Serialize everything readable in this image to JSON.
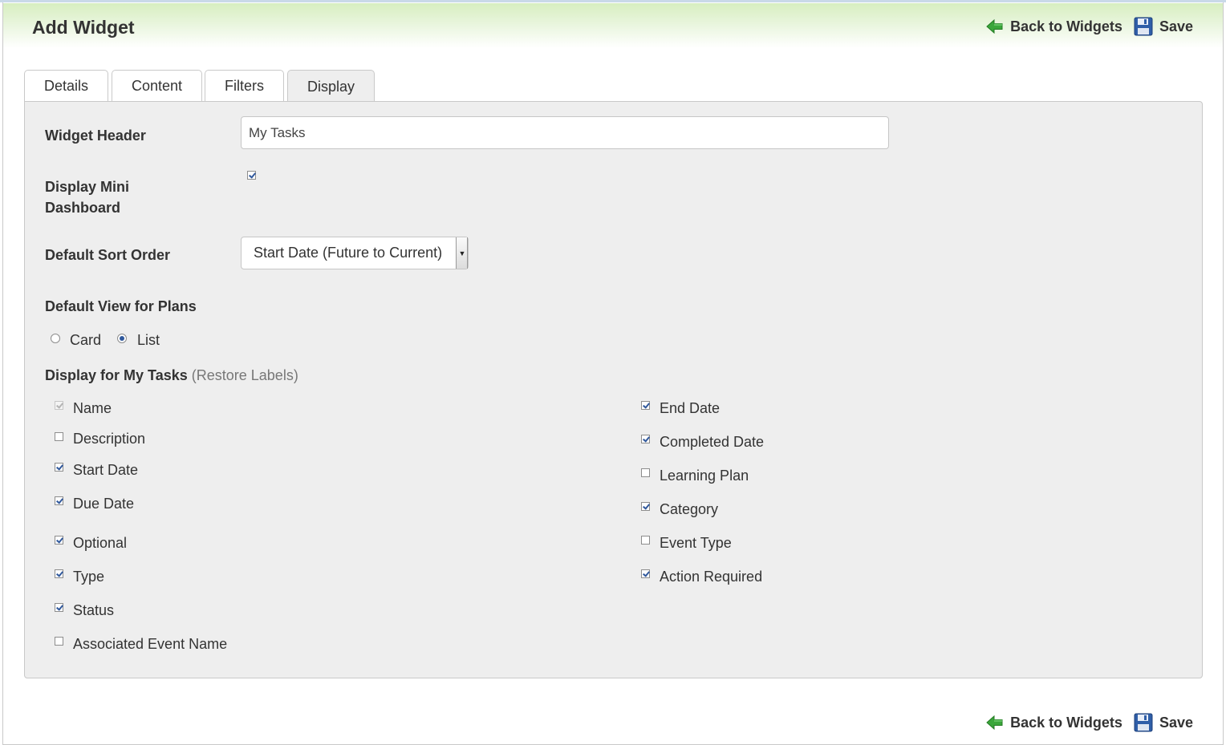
{
  "header": {
    "title": "Add Widget",
    "back_label": "Back to Widgets",
    "save_label": "Save"
  },
  "tabs": [
    {
      "label": "Details",
      "active": false
    },
    {
      "label": "Content",
      "active": false
    },
    {
      "label": "Filters",
      "active": false
    },
    {
      "label": "Display",
      "active": true
    }
  ],
  "form": {
    "widget_header": {
      "label": "Widget Header",
      "value": "My Tasks"
    },
    "mini_dashboard": {
      "label_line1": "Display Mini",
      "label_line2": "Dashboard",
      "checked": true
    },
    "sort_order": {
      "label": "Default Sort Order",
      "selected": "Start Date (Future to Current)"
    },
    "default_view": {
      "label": "Default View for Plans",
      "options": [
        {
          "label": "Card",
          "checked": false
        },
        {
          "label": "List",
          "checked": true
        }
      ]
    },
    "display_for": {
      "label": "Display for My Tasks",
      "restore_open": "(",
      "restore_label": "Restore Labels",
      "restore_close": ")"
    }
  },
  "fields_left": [
    {
      "label": "Name",
      "checked": true,
      "disabled": true
    },
    {
      "label": "Description",
      "checked": false
    },
    {
      "label": "Start Date",
      "checked": true
    },
    {
      "label": "Due Date",
      "checked": true
    },
    {
      "label": "Optional",
      "checked": true
    },
    {
      "label": "Type",
      "checked": true
    },
    {
      "label": "Status",
      "checked": true
    },
    {
      "label": "Associated Event Name",
      "checked": false
    }
  ],
  "fields_right": [
    {
      "label": "End Date",
      "checked": true
    },
    {
      "label": "Completed Date",
      "checked": true
    },
    {
      "label": "Learning Plan",
      "checked": false
    },
    {
      "label": "Category",
      "checked": true
    },
    {
      "label": "Event Type",
      "checked": false
    },
    {
      "label": "Action Required",
      "checked": true
    }
  ],
  "colors": {
    "header_gradient_top": "#d7eec0",
    "panel_bg": "#eeeeee",
    "checkbox_accent": "#30589c",
    "back_arrow": "#3aa63a",
    "save_disk": "#2f5ea8"
  }
}
